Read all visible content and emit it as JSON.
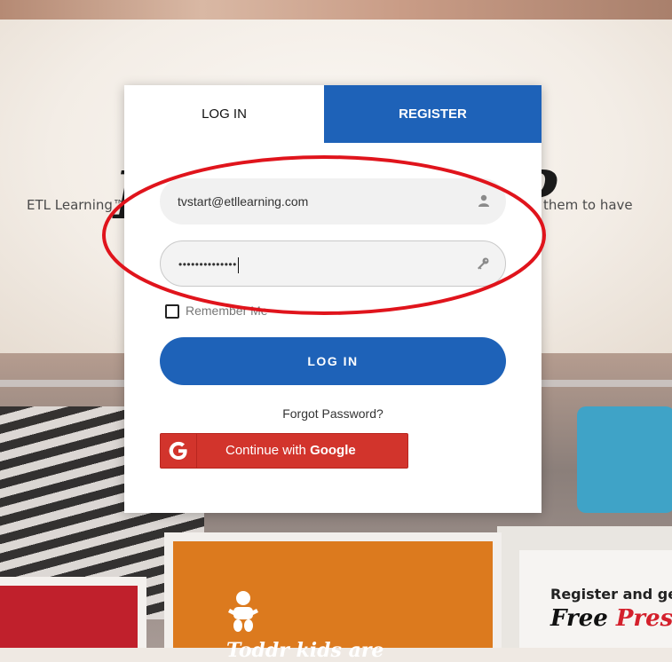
{
  "background": {
    "hero_title": "What Is Learning™?",
    "hero_text_left": "ETL Learning™",
    "hero_text_right": "them to have",
    "card_right_line1": "Register and ge",
    "card_right_free": "Free",
    "card_right_pres": "Pres",
    "card_mid_text": "Toddr kids are"
  },
  "modal": {
    "tabs": [
      {
        "label": "LOG IN",
        "active": true
      },
      {
        "label": "REGISTER",
        "active": false
      }
    ],
    "email_value": "tvstart@etllearning.com",
    "email_icon": "user-icon",
    "password_value": "••••••••••••••",
    "password_icon": "key-icon",
    "remember_label": "Remember Me",
    "remember_checked": false,
    "login_button": "LOG IN",
    "forgot_link": "Forgot Password?",
    "google_prefix": "Continue with ",
    "google_brand": "Google"
  },
  "colors": {
    "accent_blue": "#1e62b8",
    "google_red": "#d2342c",
    "annotation_red": "#e0141c"
  }
}
